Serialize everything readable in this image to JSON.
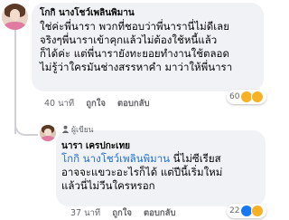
{
  "comments": [
    {
      "author": "โกกิ นางโชว์เพลินพิมาน",
      "lines": [
        "ใช่ค่ะพี่นารา พวกที่ชอบว่าพี่นารานี่ไม่ดีเลย",
        "จริงๆพี่นาราเข้าคุกแล้วไม่ต้องใช้หนี้แล้ว",
        "ก็ได้ค่ะ แต่พี่นารายังทะยอยทำงานใช้ตลอด",
        "ไม่รู้ว่าใครมันช่างสรรหาคำ มาว่าให้พี่นารา"
      ],
      "time": "40 นาที",
      "like_label": "ถูกใจ",
      "reply_label": "ตอบกลับ",
      "reaction_count": "60"
    },
    {
      "badge": "ผู้เขียน",
      "author": "นารา เครปกะเทย",
      "mention": "โกกิ นางโชว์เพลินพิมาน",
      "first_line_rest": " นี่ไม่ซีเรียส",
      "lines": [
        "อาจจะแขวะอะไรก็ได้ แต่ปีนี้เริ่มใหม่",
        "แล้วนี่ไม่วีนใครหรอก"
      ],
      "time": "37 นาที",
      "like_label": "ถูกใจ",
      "reply_label": "ตอบกลับ",
      "reaction_count": "22"
    }
  ],
  "colors": {
    "mention": "#216fdb",
    "bubble": "#f0f2f5",
    "meta": "#65676b"
  },
  "icons": [
    "haha-reaction-icon",
    "sad-reaction-icon",
    "like-reaction-icon",
    "author-badge-icon"
  ]
}
